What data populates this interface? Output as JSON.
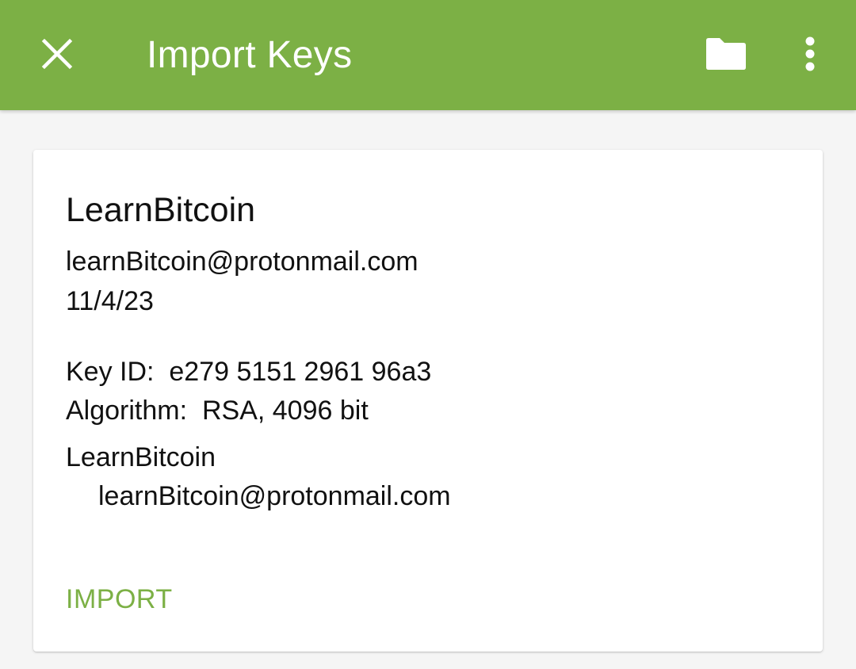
{
  "app_bar": {
    "title": "Import Keys",
    "background_color": "#7cb045",
    "icons": {
      "close": "close-icon",
      "folder": "folder-icon",
      "more": "more-vertical-icon"
    }
  },
  "key_card": {
    "name": "LearnBitcoin",
    "email": "learnBitcoin@protonmail.com",
    "date": "11/4/23",
    "key_id_label": "Key ID:",
    "key_id_value": "e279 5151 2961 96a3",
    "algorithm_label": "Algorithm:",
    "algorithm_value": "RSA, 4096 bit",
    "user_id": {
      "name": "LearnBitcoin",
      "email": "learnBitcoin@protonmail.com"
    },
    "import_label": "IMPORT",
    "accent_color": "#7cb045"
  }
}
